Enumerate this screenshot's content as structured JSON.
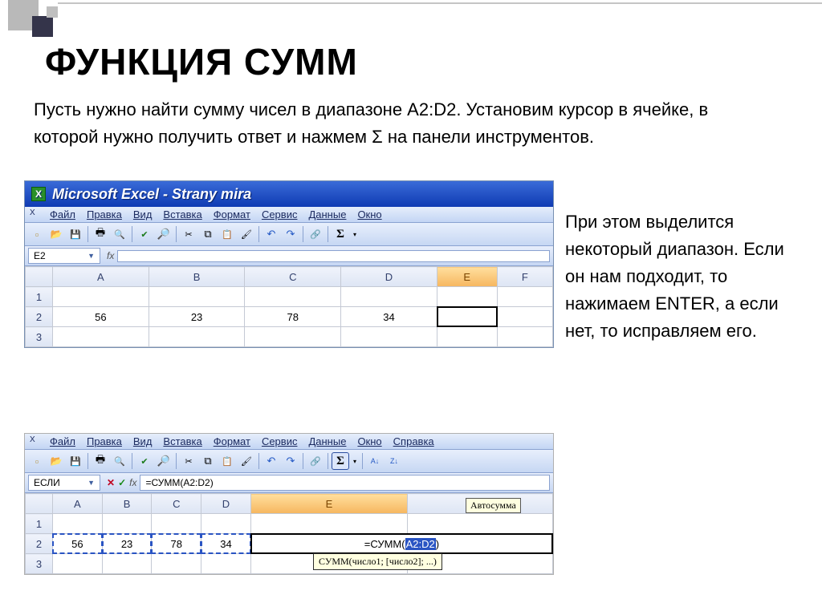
{
  "slide": {
    "title": "ФУНКЦИЯ СУММ",
    "para1": "Пусть нужно найти сумму чисел в диапазоне A2:D2. Установим курсор в ячейке, в которой нужно получить ответ и нажмем Σ на панели инструментов.",
    "side": "При этом выделится некоторый диапазон. Если он нам подходит, то нажимаем ENTER, а если нет, то исправляем его."
  },
  "shot1": {
    "app_title": "Microsoft Excel - Strany mira",
    "menu": [
      "Файл",
      "Правка",
      "Вид",
      "Вставка",
      "Формат",
      "Сервис",
      "Данные",
      "Окно"
    ],
    "namebox": "E2",
    "fx_value": "",
    "columns": [
      "A",
      "B",
      "C",
      "D",
      "E",
      "F"
    ],
    "selected_col": "E",
    "selected_row": "2",
    "data_row": [
      "56",
      "23",
      "78",
      "34"
    ]
  },
  "shot2": {
    "menu": [
      "Файл",
      "Правка",
      "Вид",
      "Вставка",
      "Формат",
      "Сервис",
      "Данные",
      "Окно",
      "Справка"
    ],
    "namebox": "ЕСЛИ",
    "fx_value": "=СУММ(A2:D2)",
    "columns": [
      "A",
      "B",
      "C",
      "D",
      "E",
      "F"
    ],
    "selected_col": "E",
    "selected_row": "2",
    "data_row": [
      "56",
      "23",
      "78",
      "34"
    ],
    "formula_display_pre": "=СУММ(",
    "formula_display_sel": "A2:D2",
    "formula_display_post": ")",
    "tooltip": "СУММ(число1; [число2]; ...)",
    "autosum_tip": "Автосумма"
  }
}
